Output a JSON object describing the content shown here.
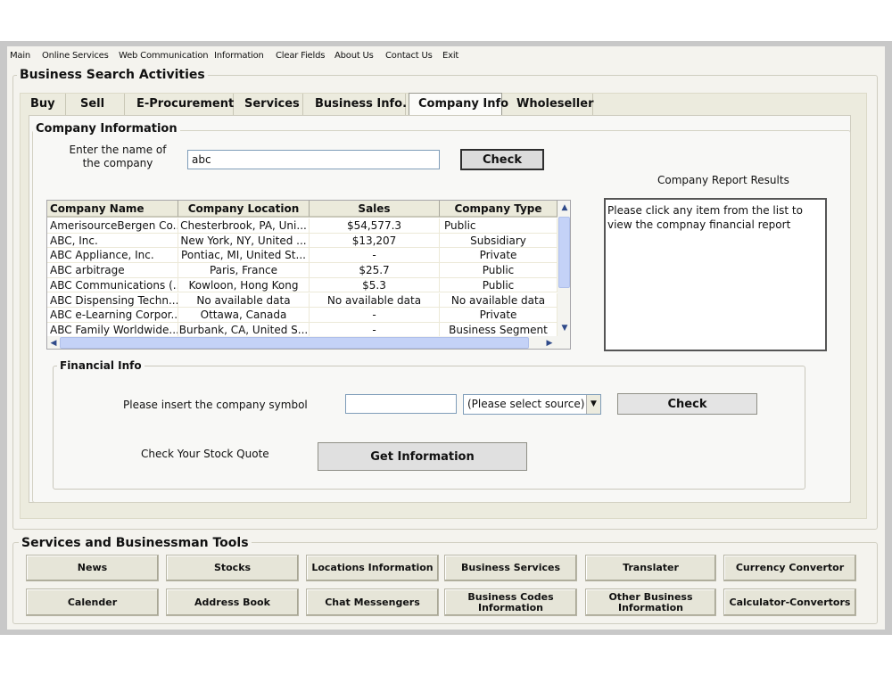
{
  "menu": [
    "Main",
    "Online Services",
    "Web Communication",
    "Information",
    "Clear Fields",
    "About Us",
    "Contact Us",
    "Exit"
  ],
  "business_search": {
    "title": "Business Search Activities",
    "tabs": [
      "Buy",
      "Sell",
      "E-Procurement",
      "Services",
      "Business Info.",
      "Company Info",
      "Wholeseller"
    ],
    "active_tab": "Company Info"
  },
  "company_info": {
    "title": "Company Information",
    "prompt_line1": "Enter the name of",
    "prompt_line2": "the company",
    "name_value": "abc",
    "check_label": "Check",
    "results_label": "Company Report Results",
    "results_text": "Please click any item from the list to view the compnay financial report",
    "columns": [
      "Company Name",
      "Company Location",
      "Sales",
      "Company Type"
    ],
    "rows": [
      [
        "AmerisourceBergen Co...",
        "Chesterbrook, PA, Uni...",
        "$54,577.3",
        "Public"
      ],
      [
        "ABC, Inc.",
        "New York, NY, United ...",
        "$13,207",
        "Subsidiary"
      ],
      [
        "ABC Appliance, Inc.",
        "Pontiac, MI, United St...",
        "-",
        "Private"
      ],
      [
        "ABC arbitrage",
        "Paris, France",
        "$25.7",
        "Public"
      ],
      [
        "ABC Communications (...",
        "Kowloon, Hong Kong",
        "$5.3",
        "Public"
      ],
      [
        "ABC Dispensing Techn...",
        "No available data",
        "No available data",
        "No available data"
      ],
      [
        "ABC e-Learning Corpor...",
        "Ottawa, Canada",
        "-",
        "Private"
      ],
      [
        "ABC Family Worldwide...",
        "Burbank, CA, United S...",
        "-",
        "Business Segment"
      ]
    ]
  },
  "financial_info": {
    "title": "Financial Info",
    "symbol_prompt": "Please insert the company symbol",
    "symbol_value": "",
    "source_selected": "(Please select source)",
    "check_label": "Check",
    "stock_prompt": "Check Your Stock Quote",
    "get_info_label": "Get Information"
  },
  "tools": {
    "title": "Services and Businessman Tools",
    "row1": [
      "News",
      "Stocks",
      "Locations Information",
      "Business Services",
      "Translater",
      "Currency Convertor"
    ],
    "row2_line1": [
      "Calender",
      "Address Book",
      "Chat Messengers",
      "Business Codes",
      "Other Business",
      "Calculator-Convertors"
    ],
    "row2_line2": [
      "",
      "",
      "",
      "Information",
      "Information",
      ""
    ]
  },
  "colors": {
    "window_bg": "#f4f3ee",
    "frame_gray": "#c8c8c8",
    "scroll_thumb": "#c4d2f7",
    "button_face": "#e6e5d8"
  }
}
